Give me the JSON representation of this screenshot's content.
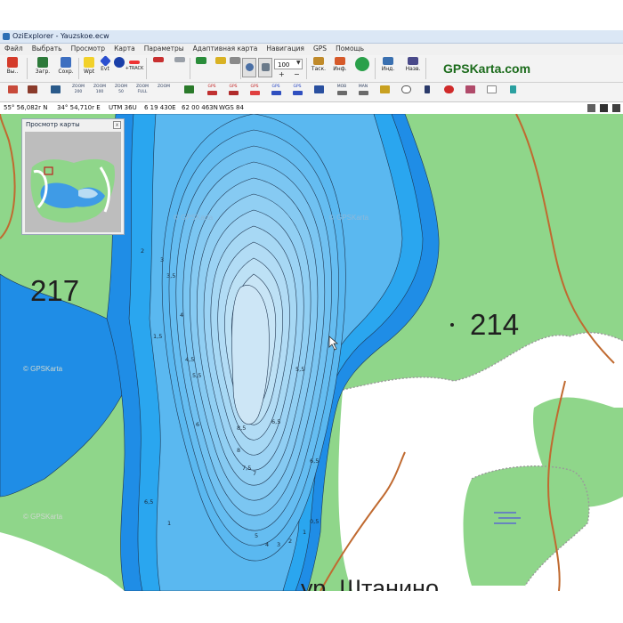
{
  "window": {
    "title": "OziExplorer - Yauzskoe.ecw"
  },
  "menu": [
    "Файл",
    "Выбрать",
    "Просмотр",
    "Карта",
    "Параметры",
    "Адаптивная карта",
    "Навигация",
    "GPS",
    "Помощь"
  ],
  "toolbar1": {
    "exit": "Вы..",
    "load": "Загр.",
    "save": "Сохр.",
    "wpt": "Wpt",
    "evt": "Evt",
    "trk": "+TRACK",
    "zoom_value": "100",
    "drag": "Таск.",
    "info": "Инф.",
    "ind": "Инд.",
    "name": "Назв.",
    "brand": "GPSKarta.com"
  },
  "toolbar2": {
    "labels": [
      "ZOOM 200",
      "ZOOM 100",
      "ZOOM 50",
      "ZOOM FULL",
      "ZOOM",
      "GPS",
      "GPS",
      "GPS",
      "GPS",
      "GPS",
      "MOB",
      "MAN"
    ]
  },
  "statusbar": {
    "lat": "55° 56,082r N",
    "lon": "34° 54,710r E",
    "utm": "UTM  36U",
    "easting": "6 19 430E",
    "northing": "62 00 463N",
    "datum": "WGS 84"
  },
  "preview": {
    "title": "Просмотр карты",
    "close": "x"
  },
  "map": {
    "label_217": "217",
    "label_214": "214",
    "place_name": "ур. Штанино",
    "watermarks": [
      "© GPSKarta",
      "© GPSKarta",
      "© GPSKarta",
      "© GPSKarta"
    ],
    "depth_labels": [
      "2",
      "3",
      "3,5",
      "4",
      "1,5",
      "4,5",
      "5,5",
      "6",
      "6,5",
      "8,5",
      "8",
      "7,5",
      "7",
      "5,5",
      "6,5",
      "1",
      "5",
      "4",
      "3",
      "2",
      "1",
      "0,5",
      "6,5"
    ],
    "colors": {
      "forest": "#8fd68a",
      "open_land": "#ffffff",
      "deep_water": "#1f8de6",
      "shallow_water": "#2aa6ef",
      "lake_center": "#cde6f6",
      "contour": "#1e3550",
      "path": "#c06a30"
    }
  }
}
